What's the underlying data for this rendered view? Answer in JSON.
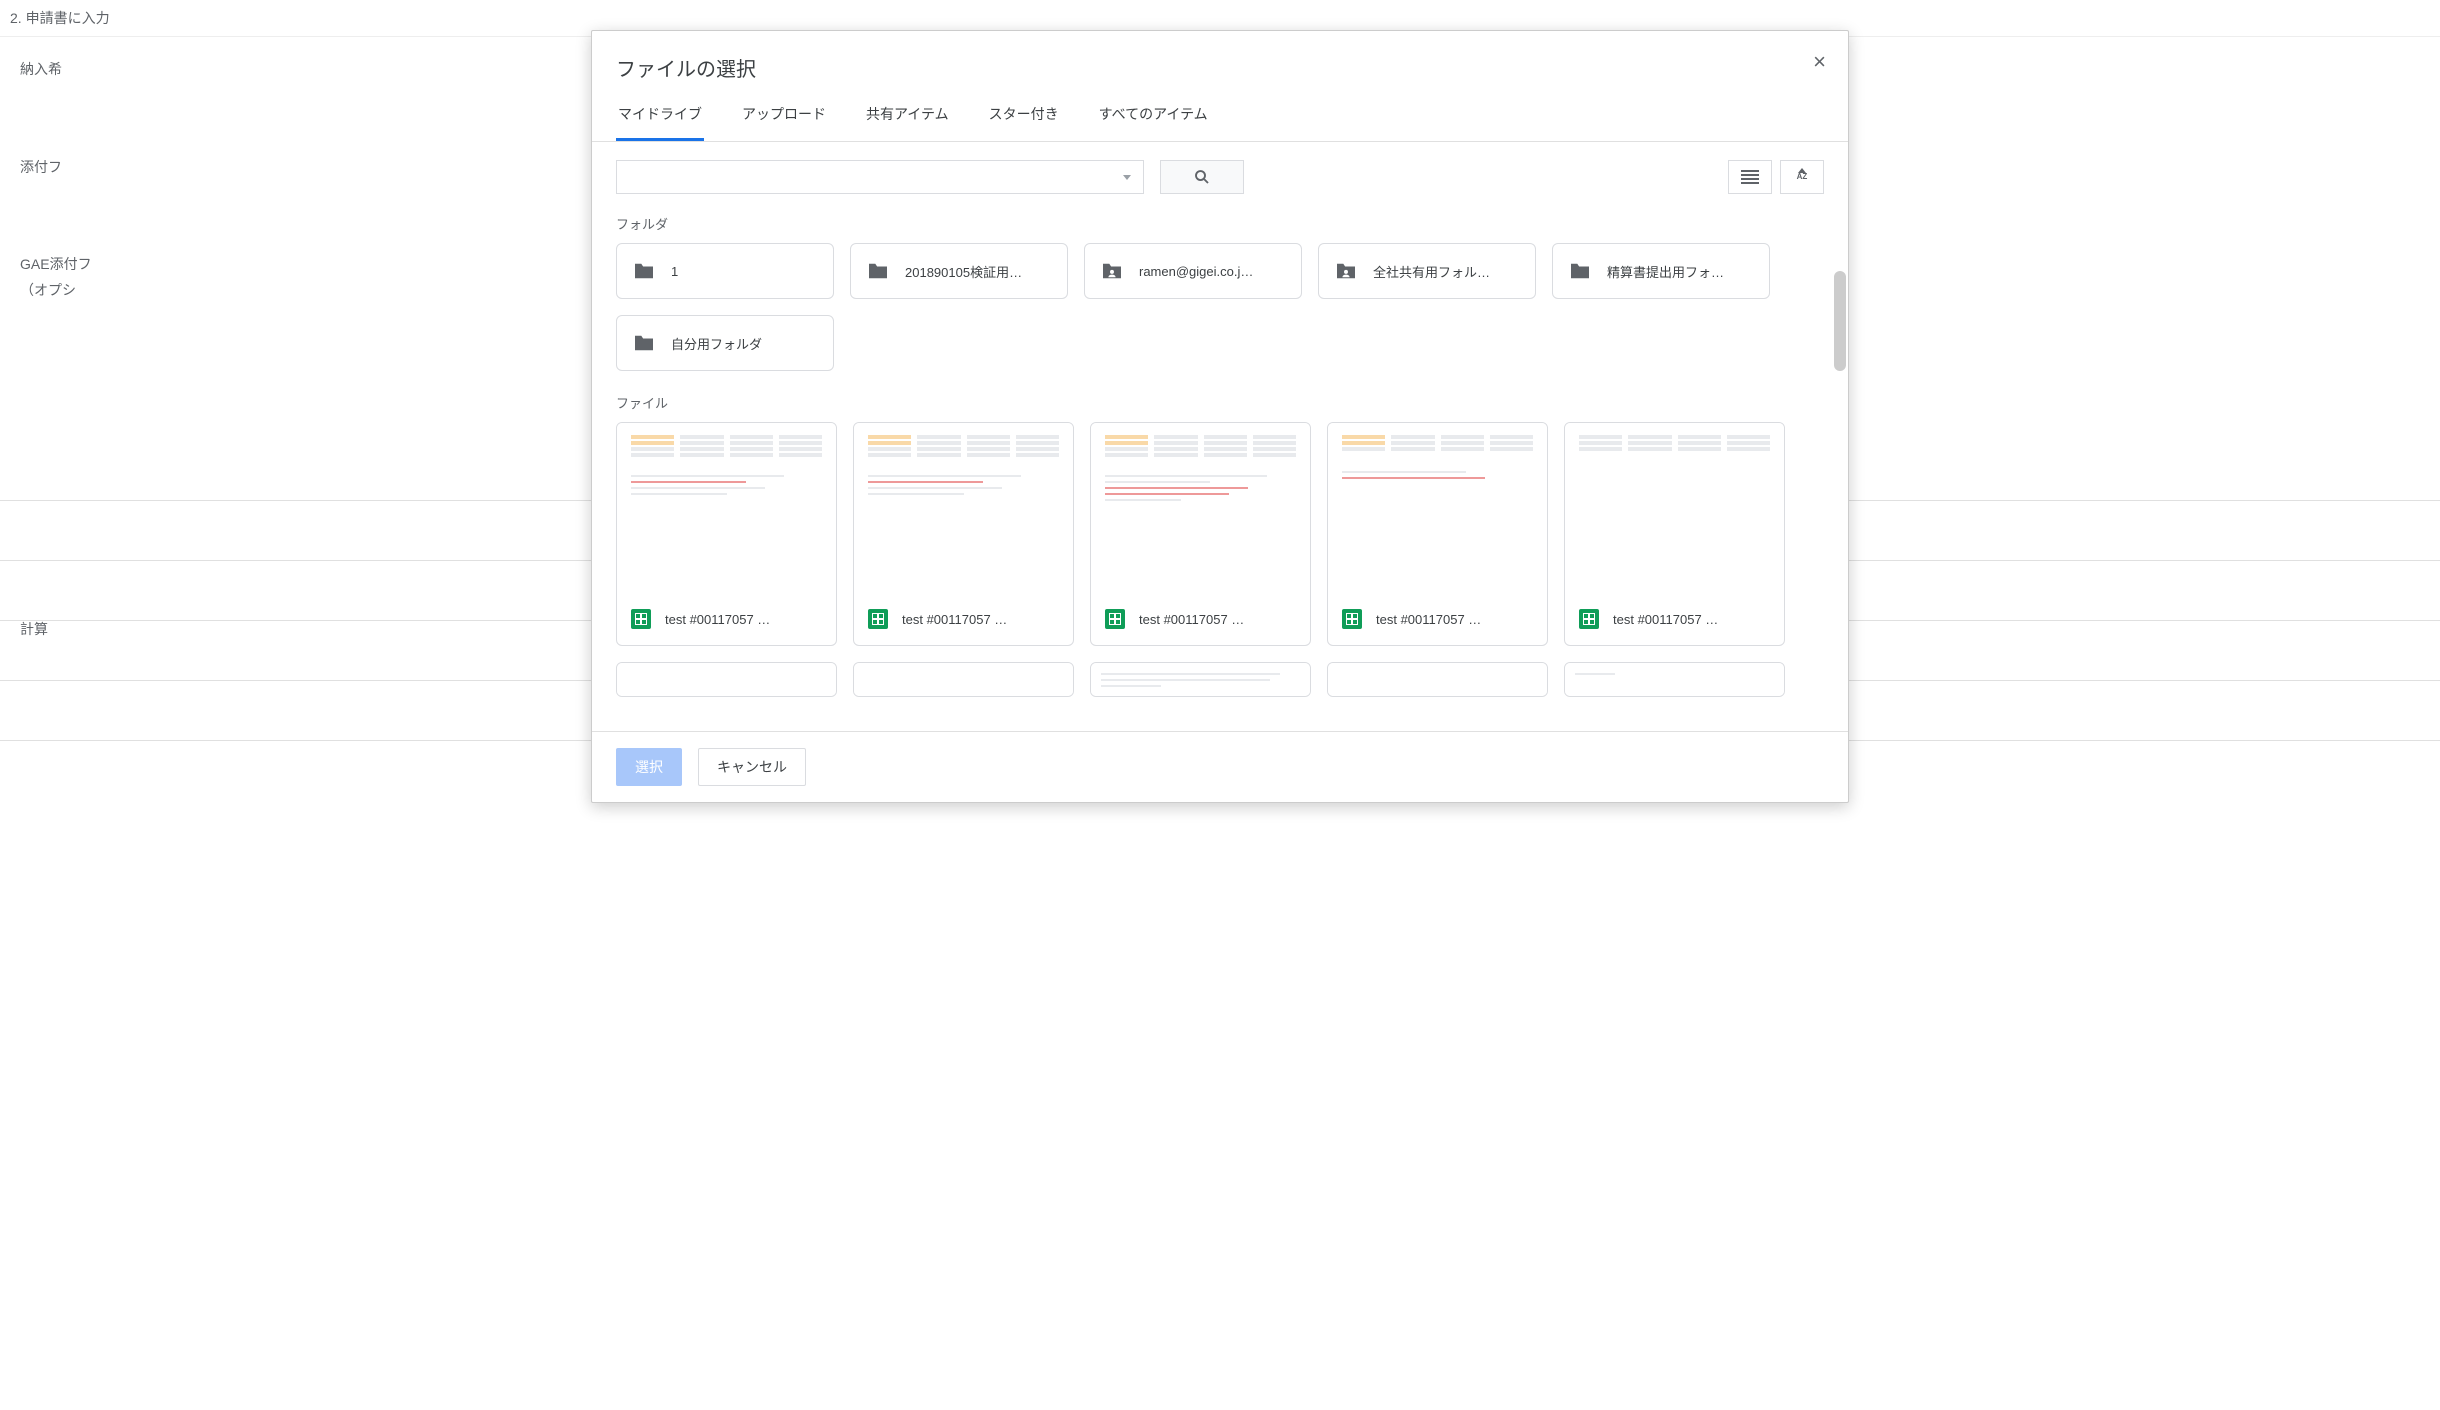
{
  "background": {
    "step_label": "2. 申請書に入力",
    "labels": [
      "納入希",
      "添付フ",
      "GAE添付フ",
      "（オプシ",
      "計算"
    ]
  },
  "modal": {
    "title": "ファイルの選択",
    "tabs": [
      {
        "label": "マイドライブ",
        "active": true
      },
      {
        "label": "アップロード",
        "active": false
      },
      {
        "label": "共有アイテム",
        "active": false
      },
      {
        "label": "スター付き",
        "active": false
      },
      {
        "label": "すべてのアイテム",
        "active": false
      }
    ],
    "search_placeholder": "",
    "sections": {
      "folders_label": "フォルダ",
      "files_label": "ファイル"
    },
    "folders": [
      {
        "name": "1",
        "type": "folder"
      },
      {
        "name": "201890105検証用…",
        "type": "folder"
      },
      {
        "name": "ramen@gigei.co.j…",
        "type": "shared"
      },
      {
        "name": "全社共有用フォル…",
        "type": "shared"
      },
      {
        "name": "精算書提出用フォ…",
        "type": "folder"
      },
      {
        "name": "自分用フォルダ",
        "type": "folder"
      }
    ],
    "files": [
      {
        "name": "test #00117057 …",
        "kind": "sheets"
      },
      {
        "name": "test #00117057 …",
        "kind": "sheets"
      },
      {
        "name": "test #00117057 …",
        "kind": "sheets"
      },
      {
        "name": "test #00117057 …",
        "kind": "sheets"
      },
      {
        "name": "test #00117057 …",
        "kind": "sheets"
      }
    ],
    "buttons": {
      "select": "選択",
      "cancel": "キャンセル"
    }
  }
}
